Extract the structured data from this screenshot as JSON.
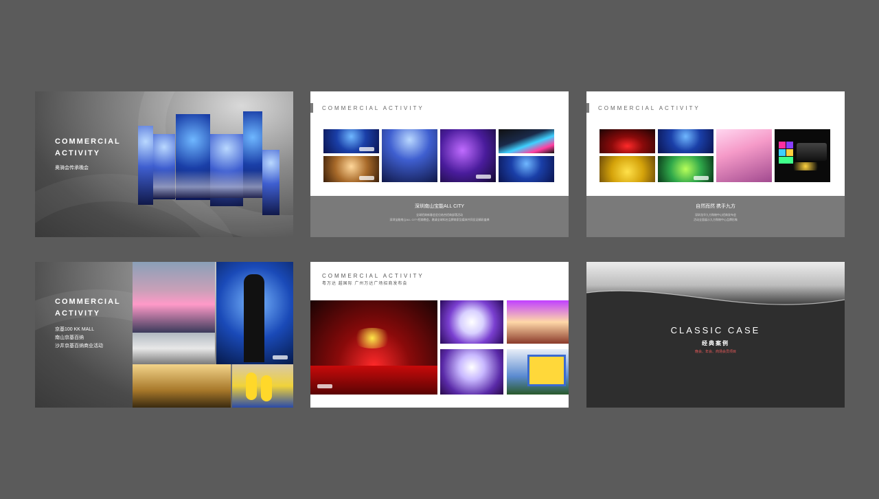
{
  "slides": {
    "s1": {
      "title_line1": "COMMERCIAL",
      "title_line2": "ACTIVITY",
      "subtitle": "奥骑会传承晚会"
    },
    "s2": {
      "tag": "COMMERCIAL ACTIVITY",
      "caption": "深圳南山宝能ALL CITY",
      "body_line1": "全球招商新春会定位结合招商部落活动",
      "body_line2": "深圳宝能南山ALL CITY招商晚会，邀请全球知名品牌商家及媒体共同见证精彩盛典"
    },
    "s3": {
      "tag": "COMMERCIAL ACTIVITY",
      "caption": "自然而然 携手九方",
      "body_line1": "深圳龙华九方购物中心招商发布会",
      "body_line2": "活动全面展示九方购物中心品牌形象"
    },
    "s4": {
      "title_line1": "COMMERCIAL",
      "title_line2": "ACTIVITY",
      "lines": [
        "京基100 KK MALL",
        "南山京基百纳",
        "沙井京基百纳商业活动"
      ]
    },
    "s5": {
      "tag": "COMMERCIAL ACTIVITY",
      "subtitle": "粤万达  越国际    广州万达广场招商发布会"
    },
    "s6": {
      "title": "CLASSIC CASE",
      "subtitle": "经典案例",
      "detail": "晚会、年会、商场会员项目"
    }
  }
}
